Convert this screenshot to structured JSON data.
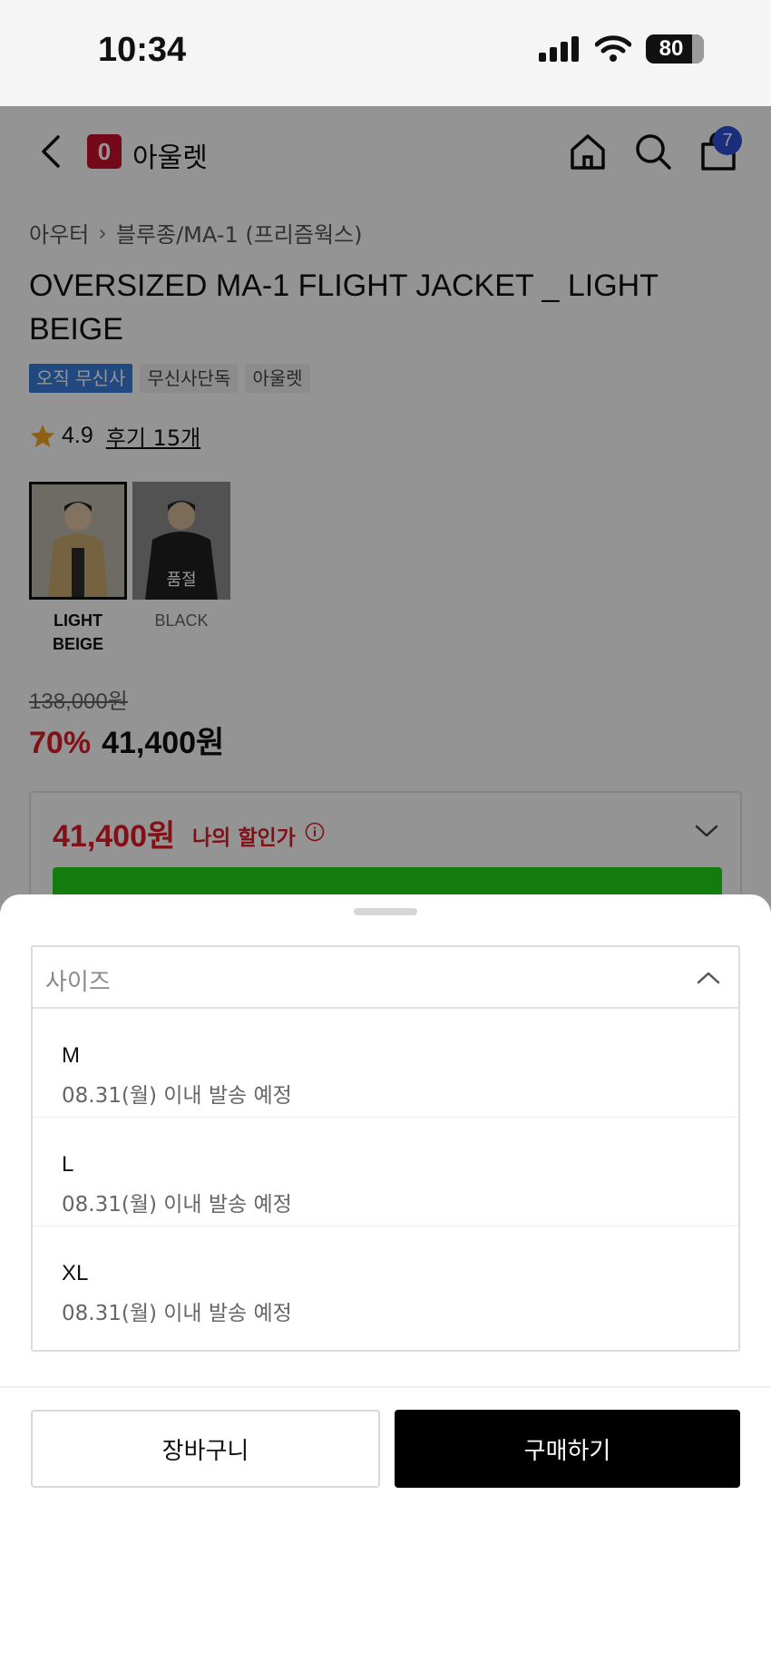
{
  "status_bar": {
    "time": "10:34",
    "battery": "80"
  },
  "header": {
    "brand_logo": "0",
    "brand_name": "아울렛",
    "cart_count": "7"
  },
  "breadcrumb": {
    "category": "아우터",
    "subcategory": "블루종/MA-1 (프리즘웍스)"
  },
  "product": {
    "title": "OVERSIZED MA-1 FLIGHT JACKET _ LIGHT BEIGE",
    "tags": [
      "오직 무신사",
      "무신사단독",
      "아울렛"
    ],
    "rating": "4.9",
    "reviews": "후기 15개",
    "colors": [
      {
        "name": "LIGHT BEIGE",
        "selected": true,
        "sold_out": ""
      },
      {
        "name": "BLACK",
        "selected": false,
        "sold_out": "품절"
      }
    ],
    "original_price": "138,000원",
    "discount": "70%",
    "sale_price": "41,400원",
    "my_price": "41,400원",
    "my_price_label": "나의 할인가"
  },
  "sheet": {
    "select_placeholder": "사이즈",
    "options": [
      {
        "size": "M",
        "shipping": "08.31(월) 이내 발송 예정"
      },
      {
        "size": "L",
        "shipping": "08.31(월) 이내 발송 예정"
      },
      {
        "size": "XL",
        "shipping": "08.31(월) 이내 발송 예정"
      }
    ],
    "cart_button": "장바구니",
    "buy_button": "구매하기"
  },
  "colors": {
    "accent_red": "#e11d28",
    "brand_red": "#c8102e",
    "badge_blue": "#2f4fd8",
    "tag_blue": "#3b7ddd",
    "promo_green": "#1fd61b"
  }
}
